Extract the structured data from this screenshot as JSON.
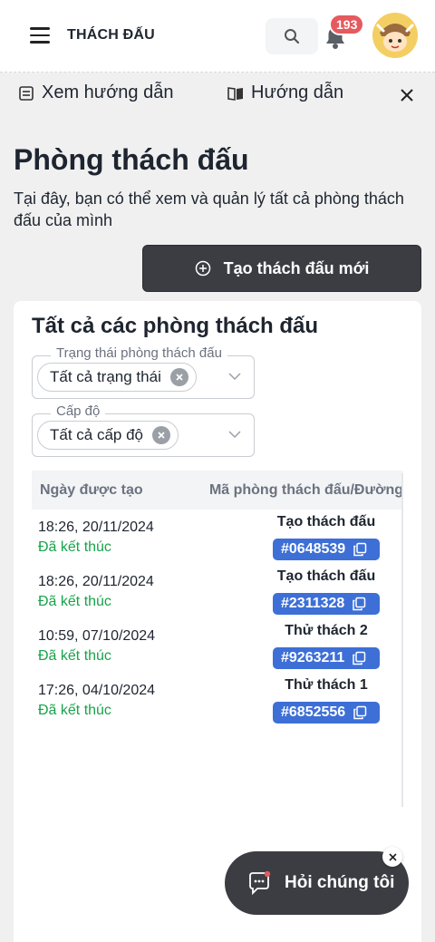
{
  "header": {
    "title": "THÁCH ĐẤU",
    "notification_count": "193",
    "icons": [
      "hamburger-icon",
      "search-icon",
      "bell-icon",
      "avatar"
    ]
  },
  "guide_bar": {
    "view_guide_label": "Xem hướng dẫn",
    "guide_label": "Hướng dẫn"
  },
  "page": {
    "title": "Phòng thách đấu",
    "description": "Tại đây, bạn có thể xem và quản lý tất cả phòng thách đấu của mình",
    "create_button": "Tạo thách đấu mới"
  },
  "card": {
    "title": "Tất cả các phòng thách đấu",
    "filters": [
      {
        "label": "Trạng thái phòng thách đấu",
        "value": "Tất cả trạng thái"
      },
      {
        "label": "Cấp độ",
        "value": "Tất cả cấp độ"
      }
    ],
    "table": {
      "headers": [
        "Ngày được tạo",
        "Mã phòng thách đấu/Đường"
      ],
      "rows": [
        {
          "date": "18:26, 20/11/2024",
          "status": "Đã kết thúc",
          "name": "Tạo thách đấu",
          "code": "#0648539"
        },
        {
          "date": "18:26, 20/11/2024",
          "status": "Đã kết thúc",
          "name": "Tạo thách đấu",
          "code": "#2311328"
        },
        {
          "date": "10:59, 07/10/2024",
          "status": "Đã kết thúc",
          "name": "Thử thách 2",
          "code": "#9263211"
        },
        {
          "date": "17:26, 04/10/2024",
          "status": "Đã kết thúc",
          "name": "Thử thách 1",
          "code": "#6852556"
        }
      ]
    }
  },
  "chat": {
    "label": "Hỏi chúng tôi"
  },
  "colors": {
    "status_green": "#17a34a",
    "code_blue": "#3d6fd6",
    "dark_button": "#3b3d42",
    "badge_red": "#e45a5f"
  }
}
